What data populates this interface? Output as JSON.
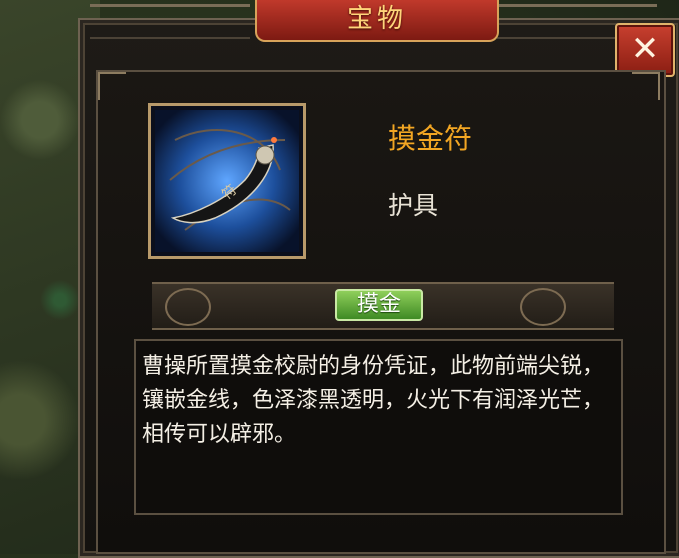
{
  "window": {
    "title": "宝物",
    "close_label": "✕"
  },
  "item": {
    "name": "摸金符",
    "type": "护具",
    "tag": "摸金",
    "icon": "talisman-pendant-icon",
    "description": "曹操所置摸金校尉的身份凭证，此物前端尖锐，镶嵌金线，色泽漆黑透明，火光下有润泽光芒，相传可以辟邪。"
  },
  "colors": {
    "title_text": "#ffd57a",
    "item_name": "#f2a623",
    "tag_green": "#3f8a24",
    "banner_red": "#c0392b"
  }
}
